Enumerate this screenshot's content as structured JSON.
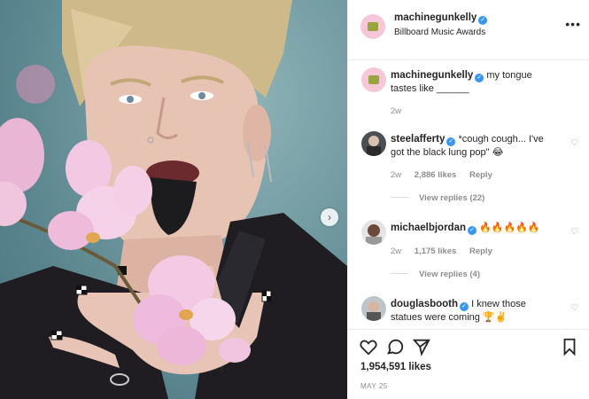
{
  "post": {
    "author": "machinegunkelly",
    "location": "Billboard Music Awards",
    "caption": "my tongue tastes like ______",
    "caption_age": "2w"
  },
  "comments": [
    {
      "user": "steelafferty",
      "text": "*cough cough... I've got the black lung pop\" 😂",
      "age": "2w",
      "likes": "2,886 likes",
      "reply_label": "Reply",
      "view_replies": "View replies (22)"
    },
    {
      "user": "michaelbjordan",
      "text": "🔥🔥🔥🔥🔥",
      "age": "2w",
      "likes": "1,175 likes",
      "reply_label": "Reply",
      "view_replies": "View replies (4)"
    },
    {
      "user": "douglasbooth",
      "text": "I knew those statues were coming 🏆✌️"
    }
  ],
  "stats": {
    "likes": "1,954,591 likes",
    "date": "MAY 25"
  },
  "icons": {
    "more": "more-options-icon",
    "verified": "verified-badge-icon",
    "next": "chevron-right-icon",
    "like": "heart-icon",
    "comment": "comment-icon",
    "share": "paper-plane-icon",
    "save": "bookmark-icon"
  },
  "colors": {
    "verified": "#3897f0",
    "meta": "#8e8e8e",
    "text": "#262626"
  }
}
